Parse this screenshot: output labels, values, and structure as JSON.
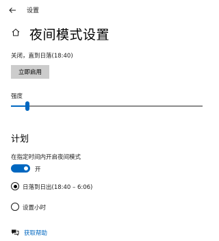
{
  "window": {
    "title": "设置"
  },
  "header": {
    "title": "夜间模式设置"
  },
  "status": {
    "text": "关闭，直到日落(18:40)"
  },
  "actions": {
    "enable_now_label": "立即启用"
  },
  "strength": {
    "label": "强度",
    "level_percent": 10
  },
  "schedule": {
    "section_title": "计划",
    "toggle_label": "在指定时间内开启夜间模式",
    "toggle_state_text": "开",
    "toggle_on": true,
    "options": [
      {
        "label": "日落到日出(18:40 – 6:06)",
        "selected": true
      },
      {
        "label": "设置小时",
        "selected": false
      }
    ]
  },
  "help": {
    "label": "获取帮助"
  },
  "colors": {
    "accent": "#0067c0",
    "button_bg": "#cccccc",
    "track": "#8a8a8a"
  },
  "icons": {
    "back": "back-arrow-icon",
    "home": "home-icon",
    "help": "help-chat-icon"
  }
}
